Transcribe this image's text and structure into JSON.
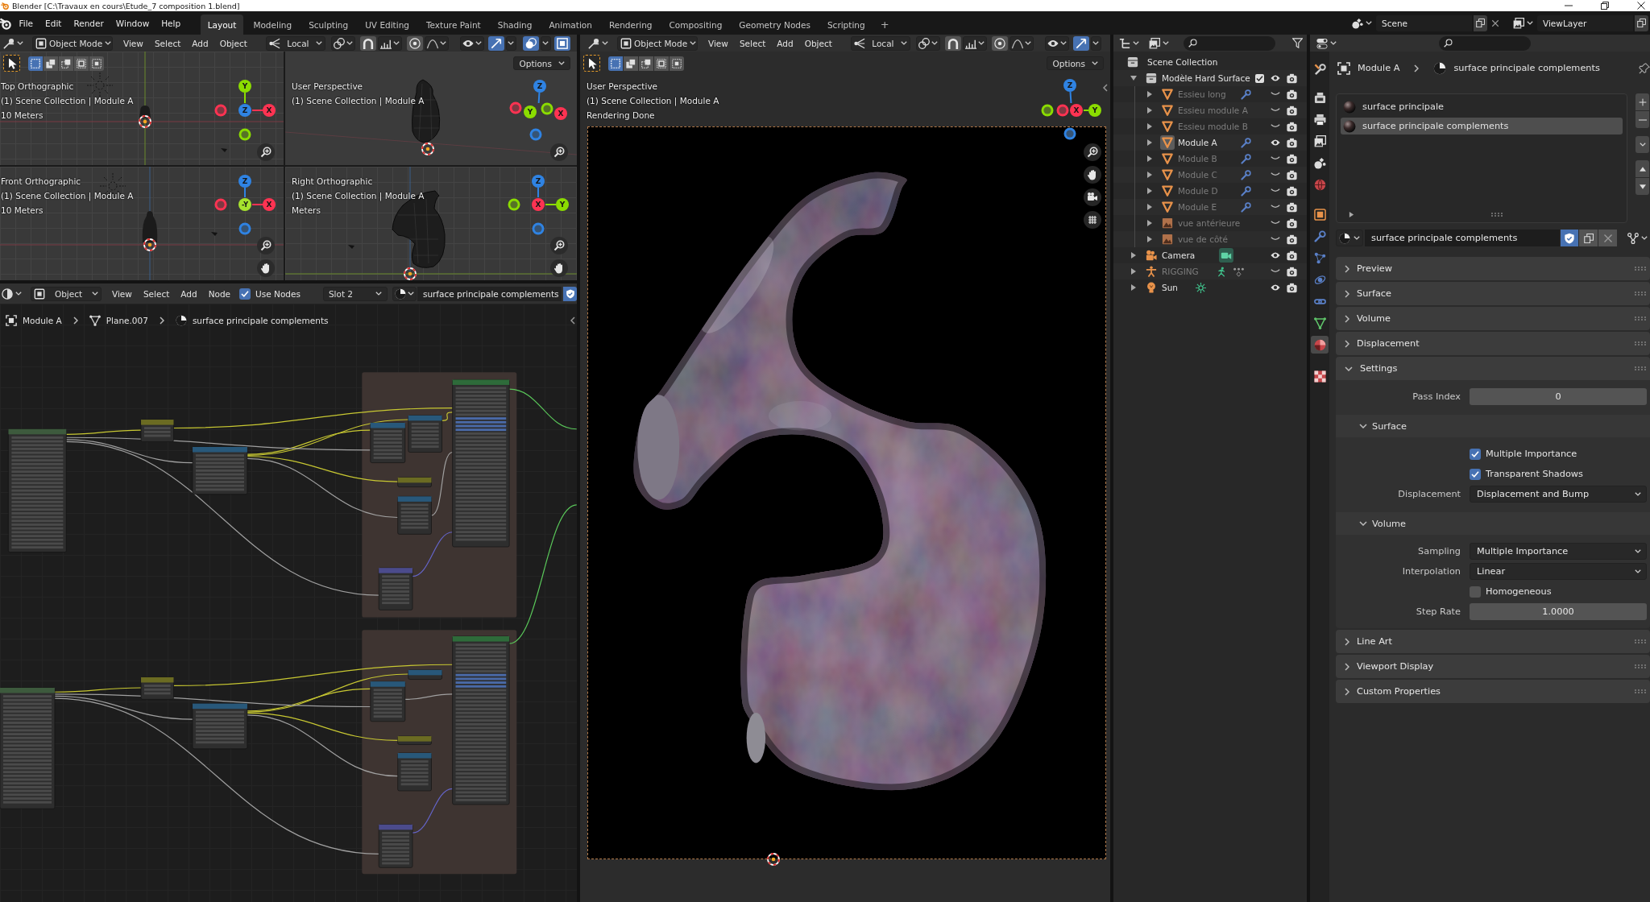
{
  "window": {
    "title": "Blender [C:\\Travaux en cours\\Etude_7 composition 1.blend]"
  },
  "topbar": {
    "menus": [
      "File",
      "Edit",
      "Render",
      "Window",
      "Help"
    ],
    "workspaces": [
      {
        "label": "Layout",
        "selected": true
      },
      {
        "label": "Modeling",
        "selected": false
      },
      {
        "label": "Sculpting",
        "selected": false
      },
      {
        "label": "UV Editing",
        "selected": false
      },
      {
        "label": "Texture Paint",
        "selected": false
      },
      {
        "label": "Shading",
        "selected": false
      },
      {
        "label": "Animation",
        "selected": false
      },
      {
        "label": "Rendering",
        "selected": false
      },
      {
        "label": "Compositing",
        "selected": false
      },
      {
        "label": "Geometry Nodes",
        "selected": false
      },
      {
        "label": "Scripting",
        "selected": false
      }
    ],
    "add_workspace": "+",
    "scene": "Scene",
    "view_layer": "ViewLayer"
  },
  "quad_view": {
    "header": {
      "mode": "Object Mode",
      "menus": [
        "View",
        "Select",
        "Add",
        "Object"
      ],
      "orientation": "Local",
      "toggles": [
        {
          "kind": "snap",
          "on": false
        },
        {
          "kind": "proportional",
          "on": false
        },
        {
          "kind": "gizmo",
          "on": true
        },
        {
          "kind": "overlay",
          "on": true
        },
        {
          "kind": "xray",
          "on": true
        }
      ]
    },
    "select_modes": [
      {
        "kind": "set",
        "selected": true
      },
      {
        "kind": "extend",
        "selected": false
      },
      {
        "kind": "subtract",
        "selected": false
      },
      {
        "kind": "invert",
        "selected": false
      },
      {
        "kind": "intersect",
        "selected": false
      }
    ],
    "options": "Options",
    "views": [
      {
        "kind": "top",
        "lines": [
          "Top Orthographic",
          "(1) Scene Collection | Module A",
          "10 Meters"
        ],
        "axes": [
          {
            "kind": "positive",
            "label": "Y",
            "color": "#8bdc00"
          },
          {
            "kind": "negative",
            "color": "#ff3352"
          },
          {
            "kind": "positive",
            "label": "Z",
            "color": "#2f83e3"
          },
          {
            "kind": "positive",
            "label": "X",
            "color": "#ff3352"
          },
          {
            "kind": "negative",
            "color": "#8bdc00"
          }
        ],
        "nav": [
          {
            "kind": "zoom"
          }
        ]
      },
      {
        "kind": "perspective",
        "lines": [
          "User Perspective",
          "(1) Scene Collection | Module A"
        ],
        "axes": [
          {
            "kind": "positive",
            "label": "Z",
            "color": "#2f83e3"
          },
          {
            "kind": "negative",
            "color": "#ff3352"
          },
          {
            "kind": "positive",
            "label": "Y",
            "color": "#8bdc00"
          },
          {
            "kind": "negative",
            "color": "#8bdc00"
          },
          {
            "kind": "positive",
            "label": "X",
            "color": "#ff3352"
          },
          {
            "kind": "negative",
            "color": "#2f83e3"
          }
        ],
        "nav": [
          {
            "kind": "zoom"
          }
        ]
      },
      {
        "kind": "front",
        "lines": [
          "Front Orthographic",
          "(1) Scene Collection | Module A",
          "10 Meters"
        ],
        "axes": [
          {
            "kind": "positive",
            "label": "Z",
            "color": "#2f83e3"
          },
          {
            "kind": "negative",
            "color": "#ff3352"
          },
          {
            "kind": "positive",
            "label": "-Y",
            "color": "#a6e22e"
          },
          {
            "kind": "positive",
            "label": "X",
            "color": "#ff3352"
          },
          {
            "kind": "negative",
            "color": "#2f83e3"
          }
        ],
        "nav": [
          {
            "kind": "zoom"
          },
          {
            "kind": "hand"
          }
        ]
      },
      {
        "kind": "right",
        "lines": [
          "Right Orthographic",
          "(1) Scene Collection | Module A",
          "Meters"
        ],
        "axes": [
          {
            "kind": "positive",
            "label": "Z",
            "color": "#2f83e3"
          },
          {
            "kind": "negative",
            "color": "#8bdc00"
          },
          {
            "kind": "positive",
            "label": "X",
            "color": "#ff3352"
          },
          {
            "kind": "positive",
            "label": "Y",
            "color": "#8bdc00"
          },
          {
            "kind": "negative",
            "color": "#2f83e3"
          }
        ],
        "nav": [
          {
            "kind": "zoom"
          },
          {
            "kind": "hand"
          }
        ]
      }
    ]
  },
  "node_editor": {
    "header": {
      "mode": "Object",
      "menus": [
        "View",
        "Select",
        "Add",
        "Node"
      ],
      "use_nodes": {
        "label": "Use Nodes",
        "checked": true
      },
      "slot": "Slot 2",
      "material": "surface principale complements",
      "fake_user": true
    },
    "breadcrumb": [
      {
        "kind": "object",
        "label": "Module A"
      },
      {
        "kind": "mesh",
        "label": "Plane.007"
      },
      {
        "kind": "material",
        "label": "surface principale complements"
      }
    ]
  },
  "render_view": {
    "kind": "camera",
    "header": {
      "mode": "Object Mode",
      "menus": [
        "View",
        "Select",
        "Add",
        "Object"
      ],
      "orientation": "Local",
      "toggles": [
        {
          "kind": "snap",
          "on": false
        },
        {
          "kind": "proportional",
          "on": false
        },
        {
          "kind": "gizmo",
          "on": true
        }
      ]
    },
    "select_modes": [
      {
        "kind": "set",
        "selected": true
      },
      {
        "kind": "extend",
        "selected": false
      },
      {
        "kind": "subtract",
        "selected": false
      },
      {
        "kind": "invert",
        "selected": false
      },
      {
        "kind": "intersect",
        "selected": false
      }
    ],
    "options": "Options",
    "lines": [
      "User Perspective",
      "(1) Scene Collection | Module A",
      "Rendering Done"
    ],
    "axes": [
      {
        "kind": "positive",
        "label": "Z",
        "color": "#2f83e3"
      },
      {
        "kind": "negative",
        "color": "#8bdc00"
      },
      {
        "kind": "negative",
        "color": "#ff3352"
      },
      {
        "kind": "positive",
        "label": "X",
        "color": "#ff3352"
      },
      {
        "kind": "positive",
        "label": "Y",
        "color": "#8bdc00"
      },
      {
        "kind": "negative",
        "color": "#2f83e3"
      }
    ],
    "nav": [
      {
        "kind": "zoom"
      },
      {
        "kind": "hand"
      },
      {
        "kind": "camera"
      },
      {
        "kind": "grid"
      }
    ]
  },
  "outliner": {
    "root": "Scene Collection",
    "items": [
      {
        "kind": "collection",
        "name": "Modèle Hard Surface",
        "expanded": true,
        "checked": true,
        "visible": true,
        "selected": false,
        "children": [
          {
            "kind": "mesh",
            "name": "Essieu long",
            "expanded": false,
            "modifier": true,
            "visible": false,
            "selected": false
          },
          {
            "kind": "mesh",
            "name": "Essieu module A",
            "expanded": false,
            "modifier": false,
            "visible": false,
            "selected": false
          },
          {
            "kind": "mesh",
            "name": "Essieu module B",
            "expanded": false,
            "modifier": false,
            "visible": false,
            "selected": false
          },
          {
            "kind": "mesh",
            "name": "Module A",
            "expanded": false,
            "modifier": true,
            "visible": true,
            "selected": true
          },
          {
            "kind": "mesh",
            "name": "Module B",
            "expanded": false,
            "modifier": true,
            "visible": false,
            "selected": false
          },
          {
            "kind": "mesh",
            "name": "Module C",
            "expanded": false,
            "modifier": true,
            "visible": false,
            "selected": false
          },
          {
            "kind": "mesh",
            "name": "Module D",
            "expanded": false,
            "modifier": true,
            "visible": false,
            "selected": false
          },
          {
            "kind": "mesh",
            "name": "Module E",
            "expanded": false,
            "modifier": true,
            "visible": false,
            "selected": false
          },
          {
            "kind": "image",
            "name": "vue antérieure",
            "expanded": false,
            "modifier": false,
            "visible": false,
            "selected": false
          },
          {
            "kind": "image",
            "name": "vue de côté",
            "expanded": false,
            "modifier": false,
            "visible": false,
            "selected": false
          }
        ]
      },
      {
        "kind": "camera",
        "name": "Camera",
        "expanded": false,
        "visible": true,
        "selected": false
      },
      {
        "kind": "armature",
        "name": "RIGGING",
        "expanded": false,
        "visible": false,
        "selected": false
      },
      {
        "kind": "light",
        "name": "Sun",
        "expanded": false,
        "visible": true,
        "selected": false
      }
    ]
  },
  "properties": {
    "tabs": [
      {
        "kind": "tool",
        "selected": false
      },
      {
        "kind": "render",
        "selected": false
      },
      {
        "kind": "output",
        "selected": false
      },
      {
        "kind": "view_layer",
        "selected": false
      },
      {
        "kind": "scene",
        "selected": false
      },
      {
        "kind": "world",
        "selected": false
      },
      {
        "kind": "object",
        "selected": false
      },
      {
        "kind": "modifiers",
        "selected": false
      },
      {
        "kind": "particles",
        "selected": false
      },
      {
        "kind": "physics",
        "selected": false
      },
      {
        "kind": "constraints",
        "selected": false
      },
      {
        "kind": "data",
        "selected": false
      },
      {
        "kind": "material",
        "selected": true
      },
      {
        "kind": "texture",
        "selected": false
      }
    ],
    "breadcrumb": [
      {
        "kind": "object",
        "label": "Module A"
      },
      {
        "kind": "material",
        "label": "surface principale complements"
      }
    ],
    "slots": [
      {
        "name": "surface principale",
        "selected": false
      },
      {
        "name": "surface principale complements",
        "selected": true
      }
    ],
    "material": "surface principale complements",
    "fake_user": true,
    "panels": [
      {
        "title": "Preview",
        "expanded": false
      },
      {
        "title": "Surface",
        "expanded": false
      },
      {
        "title": "Volume",
        "expanded": false
      },
      {
        "title": "Displacement",
        "expanded": false
      },
      {
        "title": "Settings",
        "expanded": true,
        "rows": [
          {
            "kind": "number",
            "label": "Pass Index",
            "value": "0"
          },
          {
            "kind": "subpanel",
            "title": "Surface",
            "expanded": true,
            "rows": [
              {
                "kind": "checkbox",
                "label": "Multiple Importance",
                "checked": true
              },
              {
                "kind": "checkbox",
                "label": "Transparent Shadows",
                "checked": true
              },
              {
                "kind": "dropdown",
                "label": "Displacement",
                "value": "Displacement and Bump"
              }
            ]
          },
          {
            "kind": "subpanel",
            "title": "Volume",
            "expanded": true,
            "rows": [
              {
                "kind": "dropdown",
                "label": "Sampling",
                "value": "Multiple Importance"
              },
              {
                "kind": "dropdown",
                "label": "Interpolation",
                "value": "Linear"
              },
              {
                "kind": "checkbox",
                "label": "Homogeneous",
                "checked": false
              },
              {
                "kind": "number",
                "label": "Step Rate",
                "value": "1.0000"
              }
            ]
          }
        ]
      },
      {
        "title": "Line Art",
        "expanded": false
      },
      {
        "title": "Viewport Display",
        "expanded": false
      },
      {
        "title": "Custom Properties",
        "expanded": false
      }
    ]
  }
}
